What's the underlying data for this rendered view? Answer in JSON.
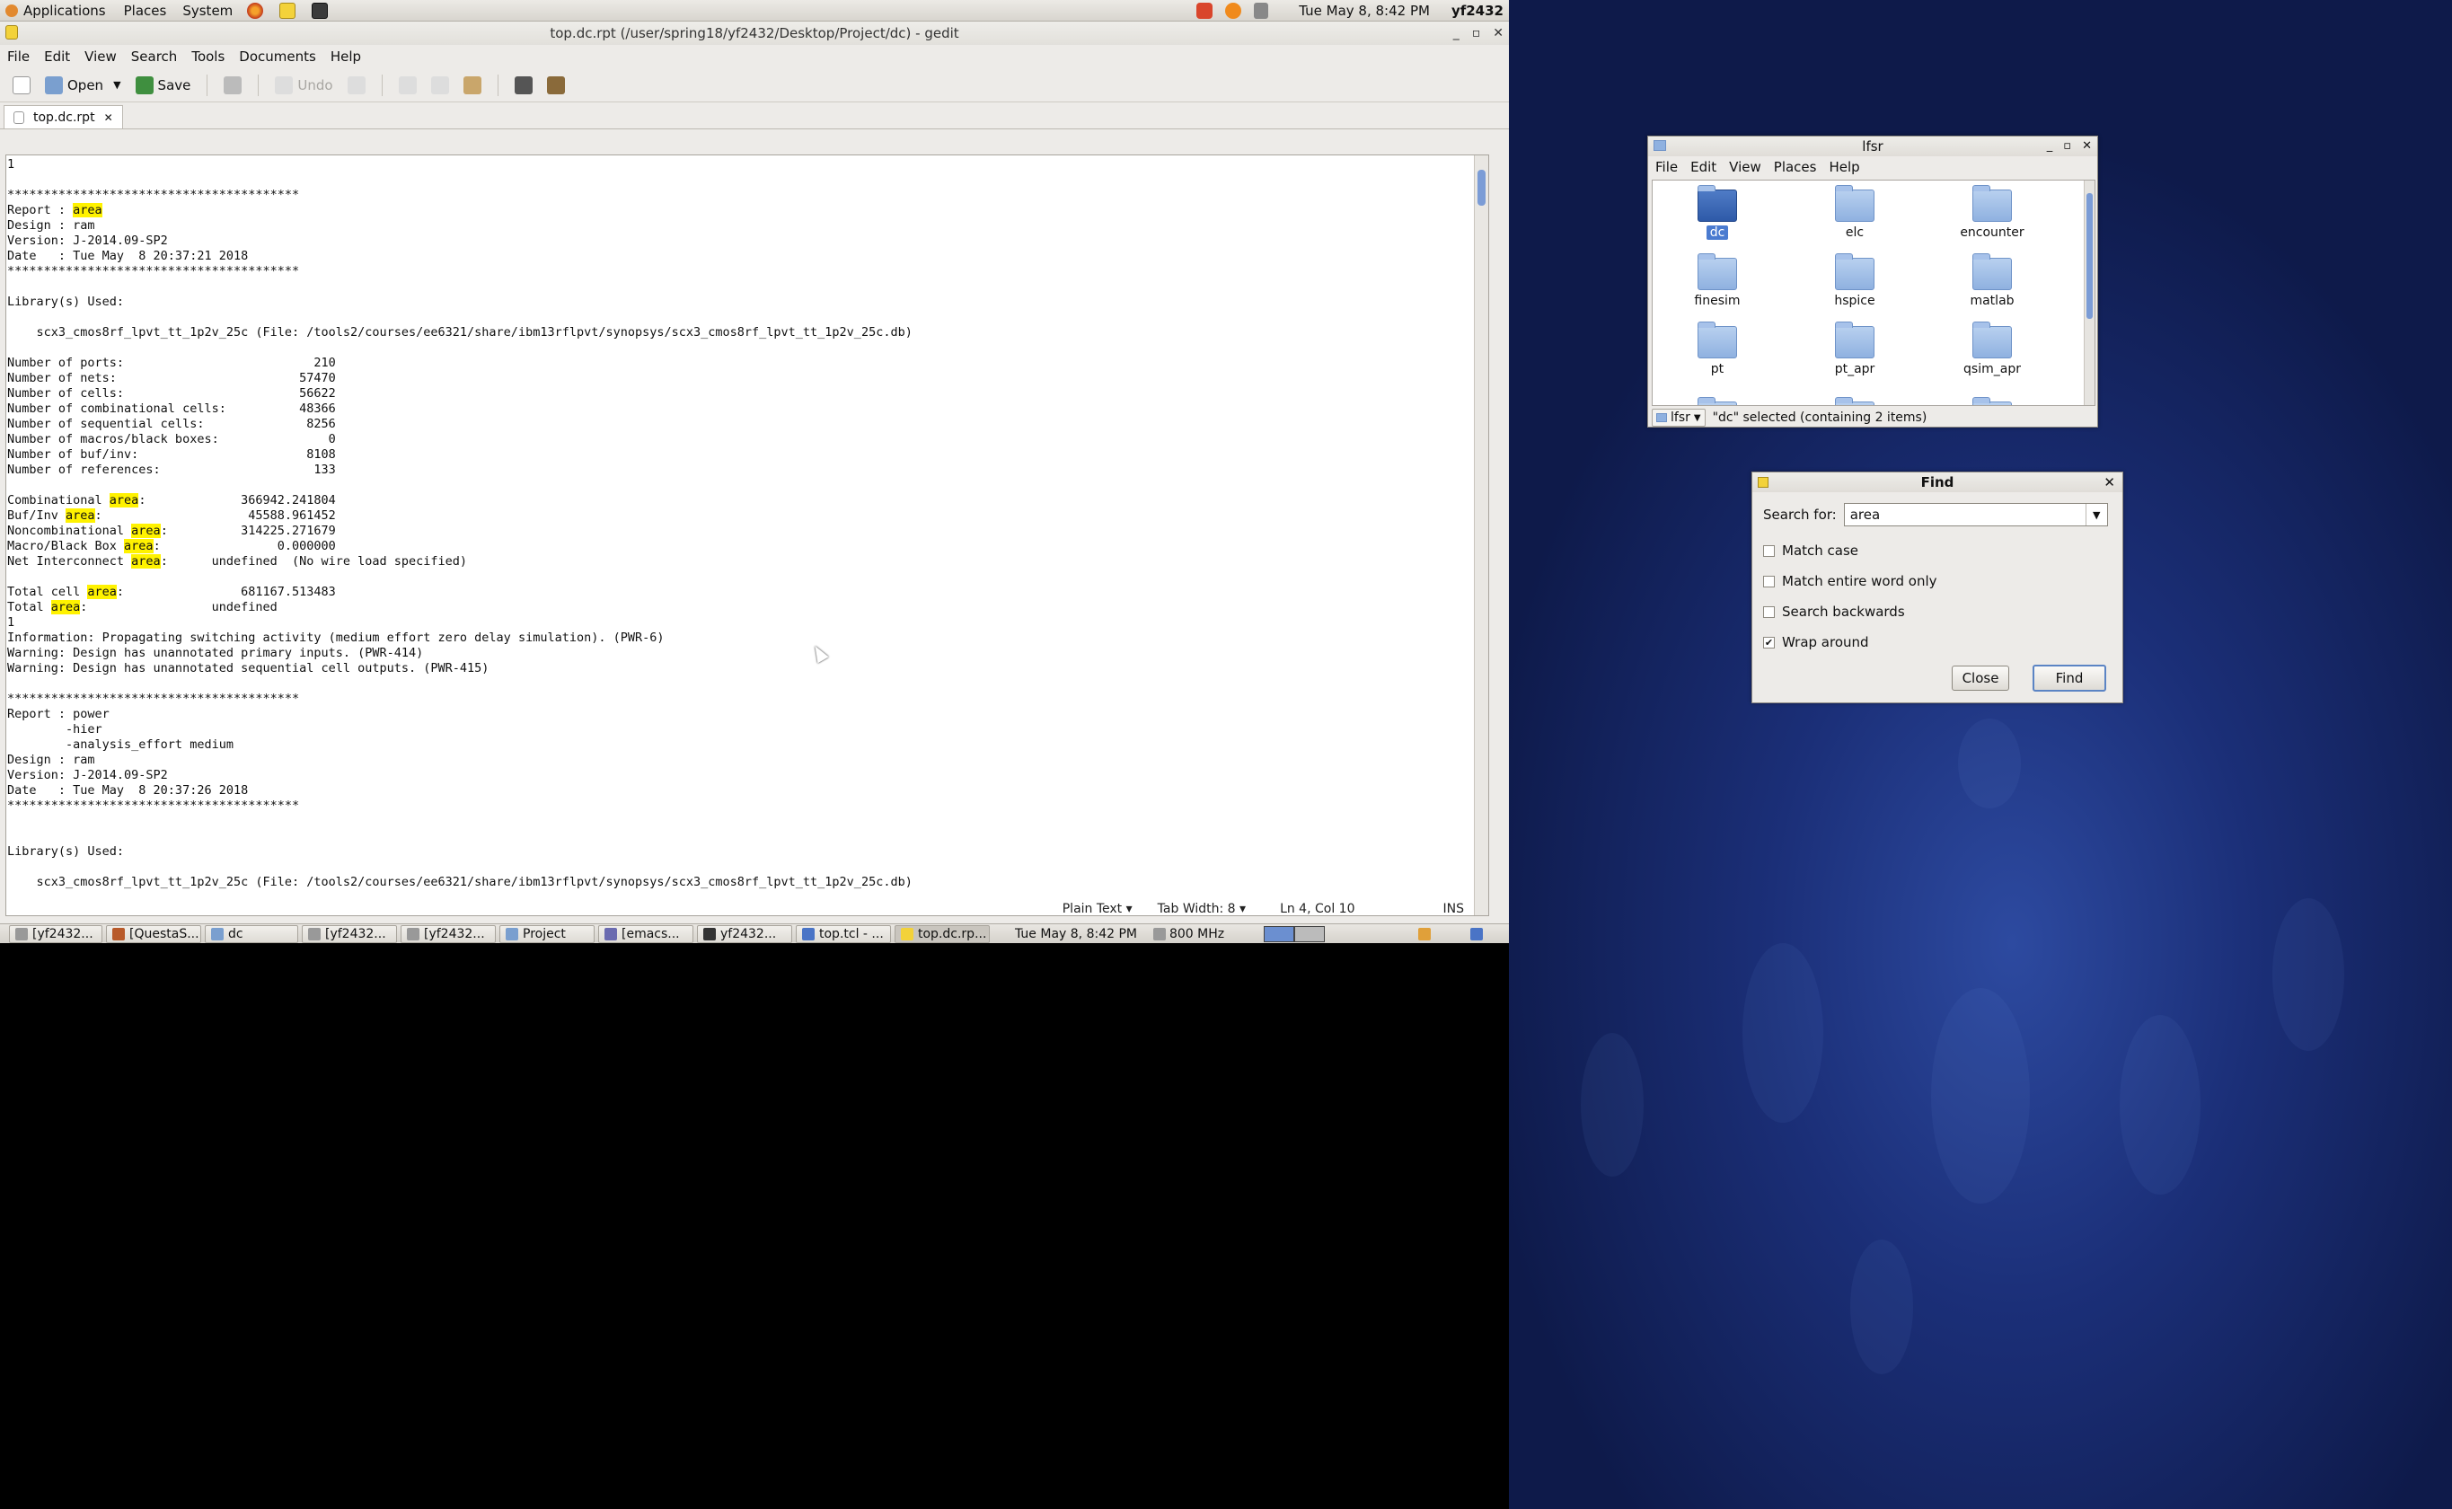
{
  "top_panel": {
    "menu": [
      "Applications",
      "Places",
      "System"
    ],
    "datetime": "Tue May  8,  8:42 PM",
    "user": "yf2432"
  },
  "gedit": {
    "title": "top.dc.rpt (/user/spring18/yf2432/Desktop/Project/dc) - gedit",
    "menu": [
      "File",
      "Edit",
      "View",
      "Search",
      "Tools",
      "Documents",
      "Help"
    ],
    "toolbar": {
      "open": "Open",
      "save": "Save",
      "undo": "Undo"
    },
    "tab_label": "top.dc.rpt",
    "highlight_term": "area",
    "lines": [
      "1",
      "",
      "****************************************",
      "Report : area",
      "Design : ram",
      "Version: J-2014.09-SP2",
      "Date   : Tue May  8 20:37:21 2018",
      "****************************************",
      "",
      "Library(s) Used:",
      "",
      "    scx3_cmos8rf_lpvt_tt_1p2v_25c (File: /tools2/courses/ee6321/share/ibm13rflpvt/synopsys/scx3_cmos8rf_lpvt_tt_1p2v_25c.db)",
      "",
      "Number of ports:                          210",
      "Number of nets:                         57470",
      "Number of cells:                        56622",
      "Number of combinational cells:          48366",
      "Number of sequential cells:              8256",
      "Number of macros/black boxes:               0",
      "Number of buf/inv:                       8108",
      "Number of references:                     133",
      "",
      "Combinational area:             366942.241804",
      "Buf/Inv area:                    45588.961452",
      "Noncombinational area:          314225.271679",
      "Macro/Black Box area:                0.000000",
      "Net Interconnect area:      undefined  (No wire load specified)",
      "",
      "Total cell area:                681167.513483",
      "Total area:                 undefined",
      "1",
      "Information: Propagating switching activity (medium effort zero delay simulation). (PWR-6)",
      "Warning: Design has unannotated primary inputs. (PWR-414)",
      "Warning: Design has unannotated sequential cell outputs. (PWR-415)",
      "",
      "****************************************",
      "Report : power",
      "        -hier",
      "        -analysis_effort medium",
      "Design : ram",
      "Version: J-2014.09-SP2",
      "Date   : Tue May  8 20:37:26 2018",
      "****************************************",
      "",
      "",
      "Library(s) Used:",
      "",
      "    scx3_cmos8rf_lpvt_tt_1p2v_25c (File: /tools2/courses/ee6321/share/ibm13rflpvt/synopsys/scx3_cmos8rf_lpvt_tt_1p2v_25c.db)"
    ],
    "status": {
      "lang": "Plain Text",
      "tab_width": "Tab Width:  8",
      "position": "Ln 4, Col 10",
      "mode": "INS"
    }
  },
  "taskbar": {
    "items": [
      "[yf2432...",
      "[QuestaS...",
      "dc",
      "[yf2432...",
      "[yf2432...",
      "Project",
      "[emacs...",
      "yf2432...",
      "top.tcl - ...",
      "top.dc.rp..."
    ],
    "active_index": 9,
    "datetime": "Tue May  8,  8:42 PM",
    "cpu": "800 MHz"
  },
  "file_manager": {
    "title": "lfsr",
    "menu": [
      "File",
      "Edit",
      "View",
      "Places",
      "Help"
    ],
    "folders": [
      "dc",
      "elc",
      "encounter",
      "finesim",
      "hspice",
      "matlab",
      "pt",
      "pt_apr",
      "qsim_apr"
    ],
    "selected": "dc",
    "path_button": "lfsr",
    "status": "\"dc\" selected (containing 2 items)"
  },
  "find_dialog": {
    "title": "Find",
    "search_label": "Search for:",
    "search_value": "area",
    "options": [
      {
        "label": "Match case",
        "checked": false
      },
      {
        "label": "Match entire word only",
        "checked": false
      },
      {
        "label": "Search backwards",
        "checked": false
      },
      {
        "label": "Wrap around",
        "checked": true
      }
    ],
    "close_label": "Close",
    "find_label": "Find"
  }
}
